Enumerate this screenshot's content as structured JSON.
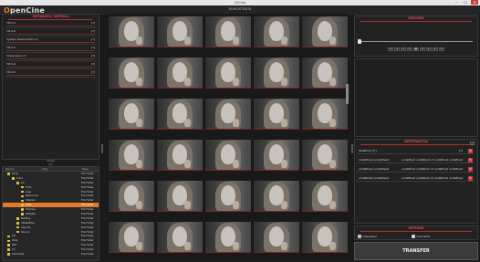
{
  "window": {
    "title": "[?]Cine",
    "controls": [
      "–",
      "☐",
      "✕"
    ]
  },
  "header": {
    "logo_o": "O",
    "logo_rest": "penCine",
    "center_label": "PLAYLISTDATA"
  },
  "metadata": {
    "title": "METADATA | DETAILS",
    "rows": [
      {
        "key": "T.B.S.1",
        "value": "[?]"
      },
      {
        "key": "T.B.S.2",
        "value": "[?]"
      },
      {
        "key": "System Resolved/U.S.2",
        "value": "[?]"
      },
      {
        "key": "T.B.S.3",
        "value": "[?]"
      },
      {
        "key": "Sharpness S.3",
        "value": "[?]"
      },
      {
        "key": "T.B.S.4",
        "value": "[?]"
      },
      {
        "key": "T.B.S.5",
        "value": "[?]"
      }
    ]
  },
  "left_tabs": [
    "Drive",
    "[?]"
  ],
  "tree": {
    "columns": [
      "Name",
      "Size",
      "Type"
    ],
    "rows": [
      {
        "name": "Temp",
        "type": "File Folder",
        "indent": 0
      },
      {
        "name": "build",
        "type": "File Folder",
        "indent": 1
      },
      {
        "name": "bin",
        "type": "File Folder",
        "indent": 2
      },
      {
        "name": "Tools",
        "type": "File Folder",
        "indent": 3
      },
      {
        "name": "Logs",
        "type": "File Folder",
        "indent": 3
      },
      {
        "name": "Resources",
        "type": "File Folder",
        "indent": 3
      },
      {
        "name": "Shaders",
        "type": "File Folder",
        "indent": 3
      },
      {
        "name": "Tests",
        "type": "File Folder",
        "indent": 3,
        "selected": true
      },
      {
        "name": "Themes",
        "type": "File Folder",
        "indent": 3
      },
      {
        "name": "Widgets",
        "type": "File Folder",
        "indent": 3
      },
      {
        "name": "NetPlay",
        "type": "File Folder",
        "indent": 2
      },
      {
        "name": "CMakeFiles",
        "type": "File Folder",
        "indent": 2
      },
      {
        "name": "imports",
        "type": "File Folder",
        "indent": 2
      },
      {
        "name": "Source",
        "type": "File Folder",
        "indent": 2
      },
      {
        "name": "Lib",
        "type": "File Folder",
        "indent": 0
      },
      {
        "name": "Data",
        "type": "File Folder",
        "indent": 0
      },
      {
        "name": "REF",
        "type": "File Folder",
        "indent": 0
      },
      {
        "name": "[?]",
        "type": "File Folder",
        "indent": 0
      },
      {
        "name": "Shot Data",
        "type": "File Folder",
        "indent": 0
      }
    ]
  },
  "thumbnails": {
    "columns": 5,
    "rows": 6
  },
  "preview": {
    "title": "PREVIEW",
    "buttons": [
      "◂",
      "◂",
      "▸",
      "▸",
      "■",
      "▸",
      "▸",
      "▸",
      "▸"
    ]
  },
  "destination": {
    "title": "DESTINATION",
    "add_label": "+",
    "rows": [
      {
        "path": "TestDrive (T:)",
        "free": "[?]"
      },
      {
        "path": "undefined (undefined)",
        "free": "undefined undefined of undefined undefined"
      },
      {
        "path": "undefined (undefined)",
        "free": "undefined undefined of undefined undefined"
      },
      {
        "path": "undefined (undefined)",
        "free": "undefined undefined of undefined undefined"
      }
    ]
  },
  "options": {
    "title": "OPTIONS",
    "items": [
      {
        "label": "Checksum",
        "checked": true
      },
      {
        "label": "Overwrite",
        "checked": false
      }
    ]
  },
  "transfer_label": "TRANSFER",
  "colors": {
    "accent": "#e07a2a",
    "title_red": "#e04848",
    "close_red": "#c83a3a"
  }
}
